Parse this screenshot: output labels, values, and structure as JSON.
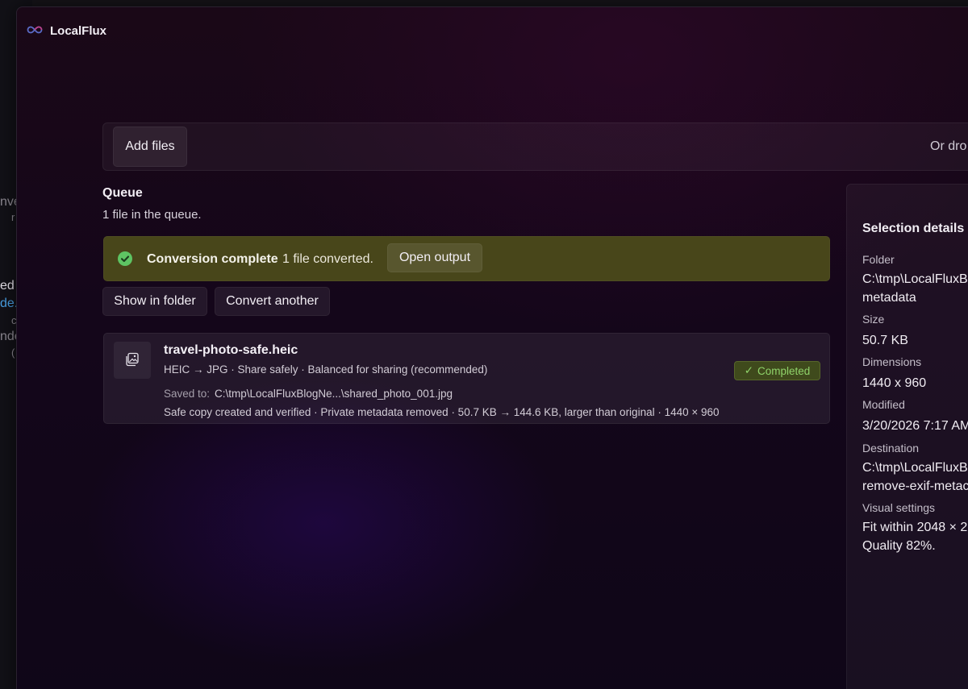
{
  "background_window": {
    "fragments": [
      "nve",
      "r",
      "ed",
      "de.",
      "c",
      "nde",
      "("
    ]
  },
  "app": {
    "title": "LocalFlux",
    "logo_icon": "infinity-logo-icon"
  },
  "dropzone": {
    "add_files_label": "Add files",
    "hint": "Or dro"
  },
  "queue": {
    "heading": "Queue",
    "subtitle": "1 file in the queue."
  },
  "banner": {
    "icon": "check-circle-icon",
    "title": "Conversion complete",
    "message": "1 file converted.",
    "open_output_label": "Open output",
    "color": "#48461a"
  },
  "actions": {
    "show_in_folder_label": "Show in folder",
    "convert_another_label": "Convert another"
  },
  "file_card": {
    "icon": "image-file-icon",
    "name": "travel-photo-safe.heic",
    "meta": "HEIC → JPG · Share safely · Balanced for sharing (recommended)",
    "saved_label": "Saved to:",
    "saved_path": "C:\\tmp\\LocalFluxBlogNe...\\shared_photo_001.jpg",
    "summary": "Safe copy created and verified · Private metadata removed · 50.7 KB → 144.6 KB, larger than original · 1440 × 960",
    "status": "Completed",
    "status_color": "#8fd36a"
  },
  "details": {
    "title": "Selection details",
    "folder_label": "Folder",
    "folder_value_1": "C:\\tmp\\LocalFluxBl",
    "folder_value_2": "metadata",
    "size_label": "Size",
    "size_value": "50.7 KB",
    "dimensions_label": "Dimensions",
    "dimensions_value": "1440 x 960",
    "modified_label": "Modified",
    "modified_value": "3/20/2026 7:17 AM",
    "destination_label": "Destination",
    "destination_value_1": "C:\\tmp\\LocalFluxBl",
    "destination_value_2": "remove-exif-metac",
    "visual_label": "Visual settings",
    "visual_value_1": "Fit within 2048 × 2",
    "visual_value_2": "Quality 82%."
  }
}
